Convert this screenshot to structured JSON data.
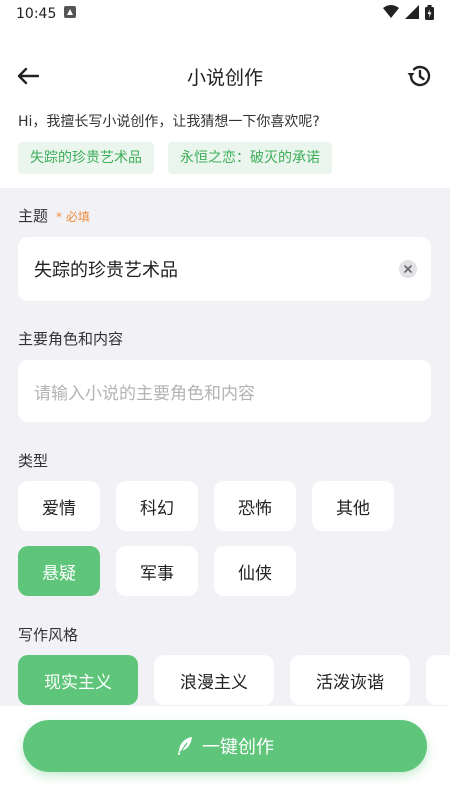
{
  "status_bar": {
    "time": "10:45"
  },
  "header": {
    "title": "小说创作"
  },
  "greeting": "Hi，我擅长写小说创作，让我猜想一下你喜欢呢?",
  "suggestions": [
    "失踪的珍贵艺术品",
    "永恒之恋：破灭的承诺"
  ],
  "theme": {
    "label": "主题",
    "required": "* 必填",
    "value": "失踪的珍贵艺术品"
  },
  "characters": {
    "label": "主要角色和内容",
    "placeholder": "请输入小说的主要角色和内容"
  },
  "genre": {
    "label": "类型",
    "options": [
      "爱情",
      "科幻",
      "恐怖",
      "其他",
      "悬疑",
      "军事",
      "仙侠"
    ],
    "selected": "悬疑"
  },
  "style": {
    "label": "写作风格",
    "options": [
      "现实主义",
      "浪漫主义",
      "活泼诙谐"
    ],
    "selected": "现实主义"
  },
  "create_button": {
    "label": "一键创作"
  },
  "colors": {
    "accent": "#5ec57a",
    "suggest_text": "#3fae5b",
    "required": "#f08c3a",
    "form_bg": "#f2f2f6"
  }
}
